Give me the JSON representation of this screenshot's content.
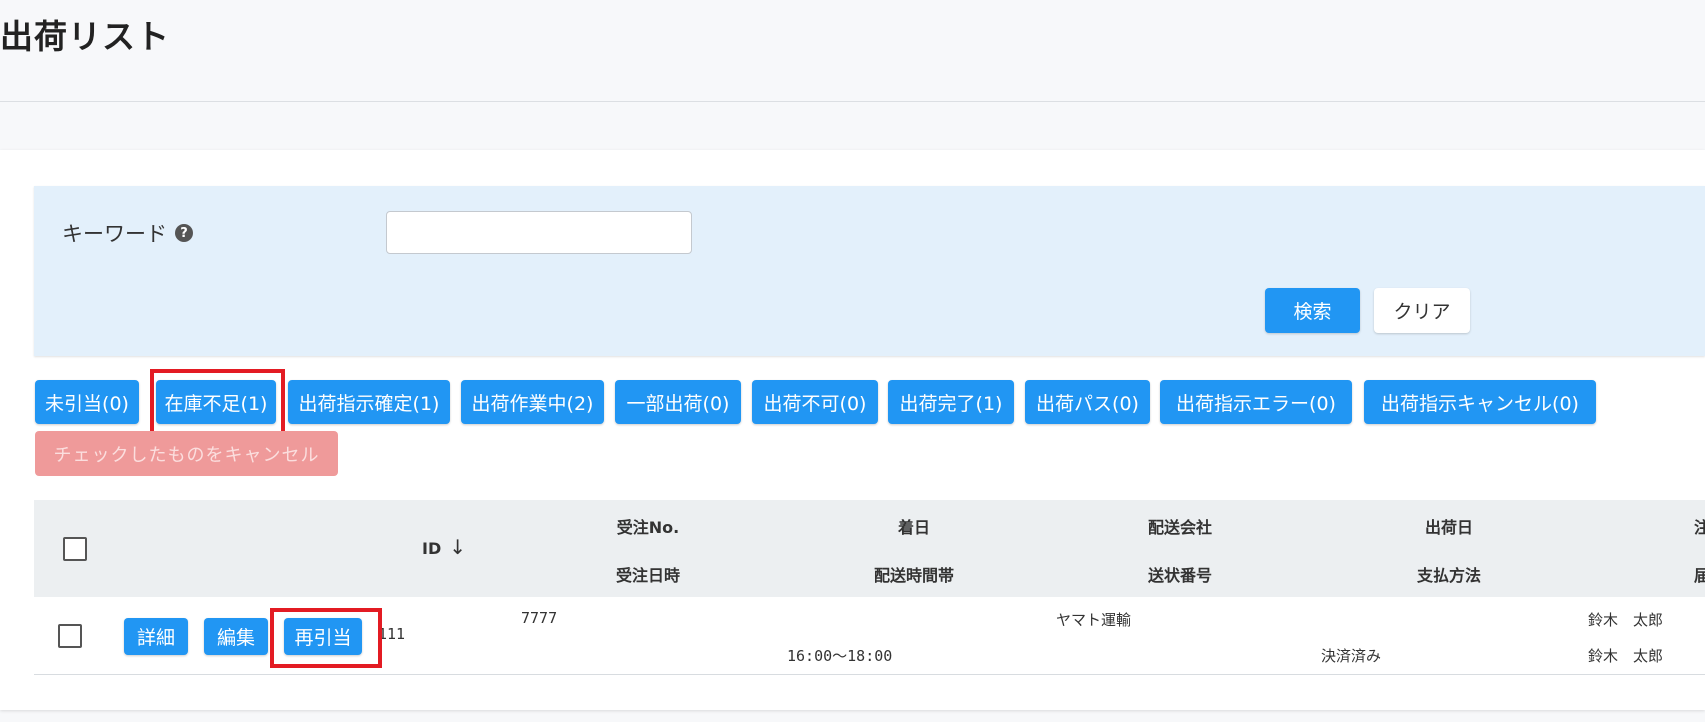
{
  "page": {
    "title": "出荷リスト"
  },
  "search": {
    "keyword_label": "キーワード",
    "keyword_value": "",
    "keyword_placeholder": "",
    "search_label": "検索",
    "clear_label": "クリア"
  },
  "status_buttons": [
    "未引当(0)",
    "在庫不足(1)",
    "出荷指示確定(1)",
    "出荷作業中(2)",
    "一部出荷(0)",
    "出荷不可(0)",
    "出荷完了(1)",
    "出荷パス(0)",
    "出荷指示エラー(0)",
    "出荷指示キャンセル(0)"
  ],
  "cancel_checked_label": "チェックしたものをキャンセル",
  "table": {
    "headers": {
      "id": "ID",
      "order_no": "受注No.",
      "order_datetime": "受注日時",
      "arrival_date": "着日",
      "delivery_time": "配送時間帯",
      "carrier": "配送会社",
      "tracking_no": "送状番号",
      "ship_date": "出荷日",
      "payment": "支払方法",
      "orderer": "注文",
      "recipient": "届け"
    },
    "row": {
      "detail_label": "詳細",
      "edit_label": "編集",
      "reallocate_label": "再引当",
      "id": "111",
      "order_no": "7777",
      "delivery_time": "16:00～18:00",
      "carrier": "ヤマト運輸",
      "payment": "決済済み",
      "orderer": "鈴木　太郎",
      "recipient": "鈴木　太郎"
    }
  }
}
